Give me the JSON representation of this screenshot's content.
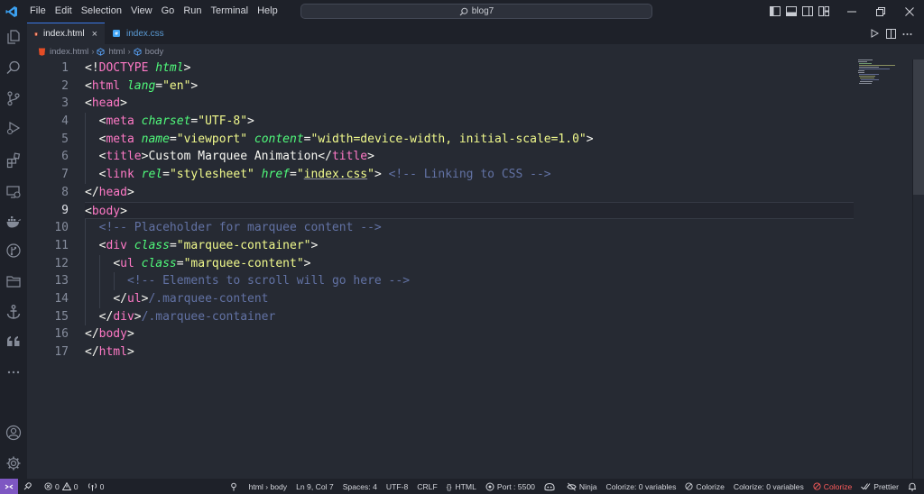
{
  "menu": [
    "File",
    "Edit",
    "Selection",
    "View",
    "Go",
    "Run",
    "Terminal",
    "Help"
  ],
  "search": {
    "text": "blog7"
  },
  "tabs": [
    {
      "label": "index.html",
      "close": "×"
    },
    {
      "label": "index.css"
    }
  ],
  "breadcrumbs": [
    "index.html",
    "html",
    "body"
  ],
  "line_numbers": [
    "1",
    "2",
    "3",
    "4",
    "5",
    "6",
    "7",
    "8",
    "9",
    "10",
    "11",
    "12",
    "13",
    "14",
    "15",
    "16",
    "17"
  ],
  "code": {
    "l1": {
      "a": "<!",
      "b": "DOCTYPE",
      "c": " html",
      "d": ">"
    },
    "l2": {
      "a": "<",
      "b": "html",
      "c": " lang",
      "d": "=",
      "e": "\"en\"",
      "f": ">"
    },
    "l3": {
      "a": "<",
      "b": "head",
      "c": ">"
    },
    "l4": {
      "a": "<",
      "b": "meta",
      "c": " charset",
      "d": "=",
      "e": "\"UTF-8\"",
      "f": ">"
    },
    "l5": {
      "a": "<",
      "b": "meta",
      "c": " name",
      "d": "=",
      "e": "\"viewport\"",
      "f": " content",
      "g": "=",
      "h": "\"width=device-width, initial-scale=1.0\"",
      "i": ">"
    },
    "l6": {
      "a": "<",
      "b": "title",
      "c": ">",
      "d": "Custom Marquee Animation",
      "e": "</",
      "f": "title",
      "g": ">"
    },
    "l7": {
      "a": "<",
      "b": "link",
      "c": " rel",
      "d": "=",
      "e": "\"stylesheet\"",
      "f": " href",
      "g": "=",
      "h": "\"",
      "i": "index.css",
      "j": "\"",
      "k": ">",
      "l": " <!-- Linking to CSS -->"
    },
    "l8": {
      "a": "</",
      "b": "head",
      "c": ">"
    },
    "l9": {
      "a": "<",
      "b": "body",
      "c": ">"
    },
    "l10": {
      "a": "<!-- Placeholder for marquee content -->"
    },
    "l11": {
      "a": "<",
      "b": "div",
      "c": " class",
      "d": "=",
      "e": "\"marquee-container\"",
      "f": ">"
    },
    "l12": {
      "a": "<",
      "b": "ul",
      "c": " class",
      "d": "=",
      "e": "\"marquee-content\"",
      "f": ">"
    },
    "l13": {
      "a": "<!-- Elements to scroll will go here -->"
    },
    "l14": {
      "a": "</",
      "b": "ul",
      "c": ">",
      "d": "/.marquee-content"
    },
    "l15": {
      "a": "</",
      "b": "div",
      "c": ">",
      "d": "/.marquee-container"
    },
    "l16": {
      "a": "</",
      "b": "body",
      "c": ">"
    },
    "l17": {
      "a": "</",
      "b": "html",
      "c": ">"
    }
  },
  "status": {
    "errors": "0",
    "warnings": "0",
    "ports": "0",
    "breadcrumb": "html › body",
    "position": "Ln 9, Col 7",
    "spaces": "Spaces: 4",
    "encoding": "UTF-8",
    "eol": "CRLF",
    "language_braces": "{}",
    "language": "HTML",
    "port": "Port : 5500",
    "ninja": "Ninja",
    "colorize_vars_1": "Colorize: 0 variables",
    "colorize_1": "Colorize",
    "colorize_vars_2": "Colorize: 0 variables",
    "colorize_2": "Colorize",
    "prettier": "Prettier"
  },
  "colors": {
    "tag": "#ff79c6",
    "attribute": "#50fa7b",
    "string": "#f1fa8c",
    "comment": "#6272a4",
    "accent": "#3b78e7",
    "error": "#ff5c5c"
  }
}
